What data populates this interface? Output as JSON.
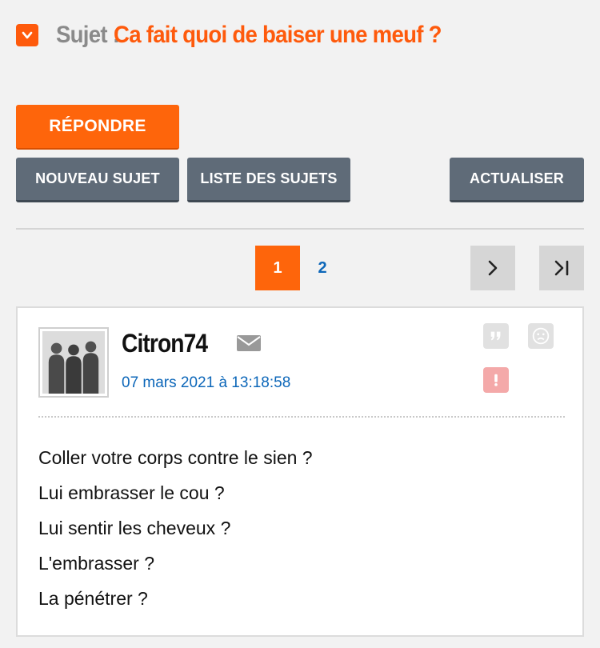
{
  "topic": {
    "prefix": "Sujet :",
    "title": "Ca fait quoi de baiser une meuf ?",
    "collapse_icon": "chevron-down-icon"
  },
  "actions": {
    "reply": "RÉPONDRE",
    "new_topic": "NOUVEAU SUJET",
    "topic_list": "LISTE DES SUJETS",
    "refresh": "ACTUALISER"
  },
  "pagination": {
    "current": "1",
    "pages": [
      "2"
    ],
    "next_icon": "chevron-right-icon",
    "last_icon": "last-page-icon"
  },
  "post": {
    "author": "Citron74",
    "date": "07 mars 2021 à 13:18:58",
    "lines": [
      "Coller votre corps contre le sien ?",
      "Lui embrasser le cou ?",
      "Lui sentir les cheveux ?",
      "L'embrasser ?",
      "La pénétrer ?"
    ],
    "icons": [
      "mail-icon",
      "quote-icon",
      "sad-face-icon",
      "alert-icon"
    ]
  },
  "colors": {
    "accent": "#fe650b",
    "link": "#0d67b9",
    "button_gray": "#5f6b78",
    "alert": "#f4a9a9"
  }
}
